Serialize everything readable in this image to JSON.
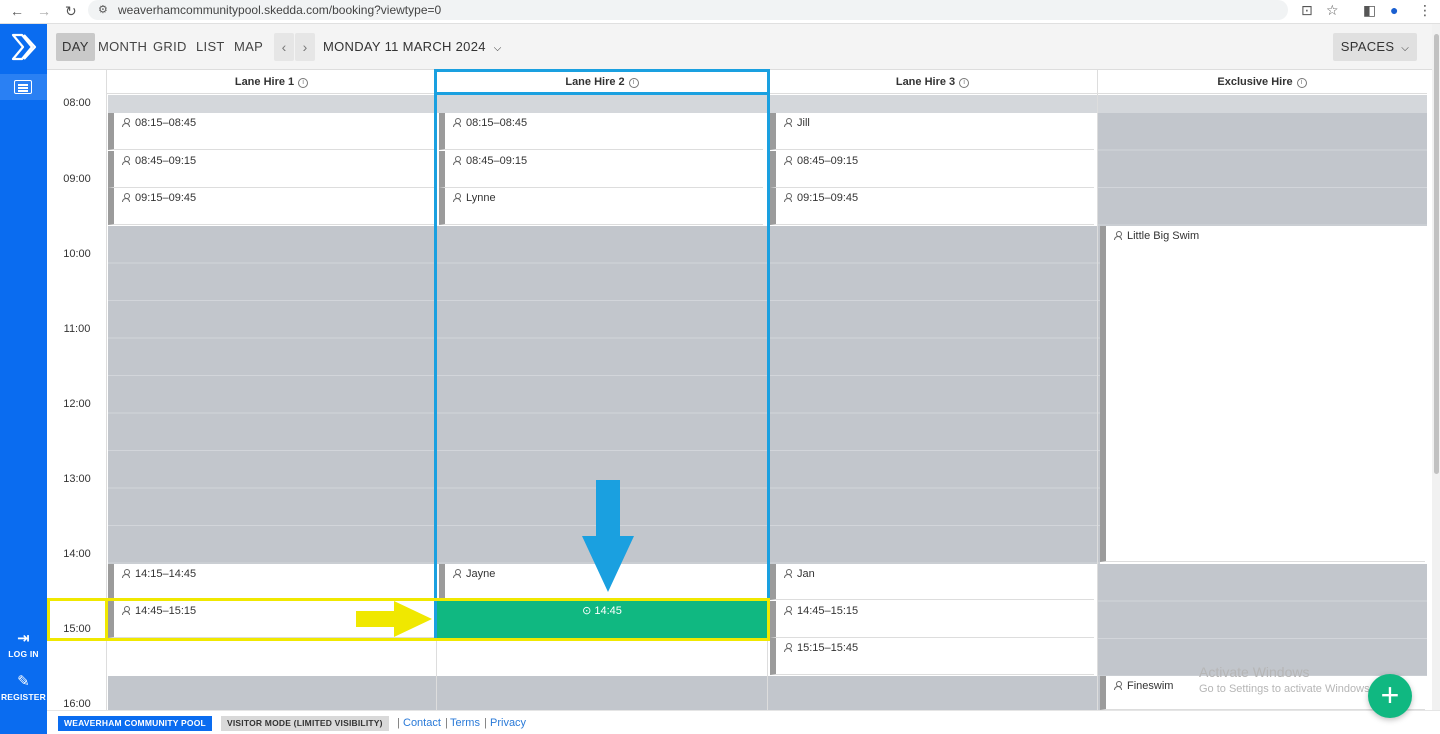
{
  "browser": {
    "url": "weaverhamcommunitypool.skedda.com/booking?viewtype=0",
    "back_icon": "back-arrow-icon",
    "forward_icon": "forward-arrow-icon",
    "reload_icon": "reload-icon"
  },
  "sidebar": {
    "login_label": "LOG IN",
    "register_label": "REGISTER"
  },
  "toolbar": {
    "views": [
      "DAY",
      "MONTH",
      "GRID",
      "LIST",
      "MAP"
    ],
    "active_view": "DAY",
    "prev": "‹",
    "next": "›",
    "date": "MONDAY 11 MARCH 2024",
    "spaces_label": "SPACES"
  },
  "columns": [
    {
      "name": "Lane Hire 1"
    },
    {
      "name": "Lane Hire 2"
    },
    {
      "name": "Lane Hire 3"
    },
    {
      "name": "Exclusive Hire"
    }
  ],
  "times": [
    "08:00",
    "09:00",
    "10:00",
    "11:00",
    "12:00",
    "13:00",
    "14:00",
    "15:00",
    "16:00"
  ],
  "bookings": {
    "lane1": [
      "08:15–08:45",
      "08:45–09:15",
      "09:15–09:45",
      "14:15–14:45",
      "14:45–15:15"
    ],
    "lane2": [
      "08:15–08:45",
      "08:45–09:15",
      "Lynne",
      "Jayne"
    ],
    "lane3": [
      "Jill",
      "08:45–09:15",
      "09:15–09:45",
      "Jan",
      "14:45–15:15",
      "15:15–15:45"
    ],
    "exclusive": [
      "Little Big Swim",
      "Fineswim"
    ]
  },
  "selected_slot": {
    "label": "14:45",
    "color": "#10b881"
  },
  "footer": {
    "venue": "WEAVERHAM COMMUNITY POOL",
    "mode": "VISITOR MODE (LIMITED VISIBILITY)",
    "links": [
      "Contact",
      "Terms",
      "Privacy"
    ]
  },
  "watermark": {
    "line1": "Activate Windows",
    "line2": "Go to Settings to activate Windows."
  },
  "colors": {
    "brand": "#0a6cf0",
    "selection": "#10b881",
    "annotation_blue": "#1aa0e0",
    "annotation_yellow": "#f0e800"
  }
}
